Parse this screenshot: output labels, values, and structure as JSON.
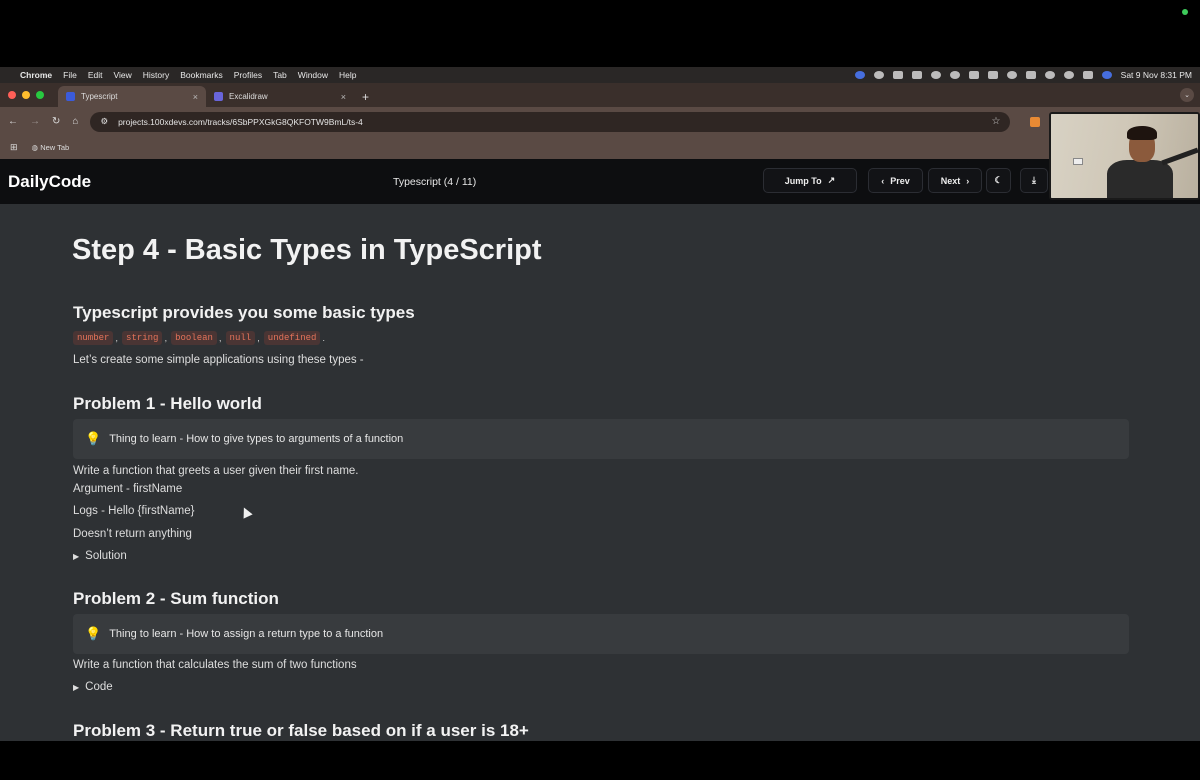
{
  "menubar": {
    "items": [
      "Chrome",
      "File",
      "Edit",
      "View",
      "History",
      "Bookmarks",
      "Profiles",
      "Tab",
      "Window",
      "Help"
    ],
    "datetime": "Sat 9 Nov  8:31 PM"
  },
  "browser": {
    "tabs": [
      {
        "label": "Typescript",
        "close": "×"
      },
      {
        "label": "Excalidraw",
        "close": "×"
      }
    ],
    "new_tab": "+",
    "url": "projects.100xdevs.com/tracks/6SbPPXGkG8QKFOTW9BmL/ts-4",
    "bookmark": "New Tab"
  },
  "site": {
    "logo": "DailyCode",
    "breadcrumb": "Typescript (4 / 11)",
    "jump_to": "Jump To",
    "prev": "Prev",
    "next": "Next"
  },
  "content": {
    "title": "Step 4 - Basic Types in TypeScript",
    "section_heading": "Typescript provides you some basic types",
    "types": [
      "number",
      "string",
      "boolean",
      "null",
      "undefined"
    ],
    "intro": "Let’s create some simple applications using these types -",
    "problem1": {
      "heading": "Problem 1 - Hello world",
      "callout": "Thing to learn - How to give types to arguments of a function",
      "line1": "Write a function that greets a user given their first name.",
      "line2": "Argument - firstName",
      "line3": "Logs - Hello {firstName}",
      "line4": "Doesn’t return anything",
      "toggle": "Solution"
    },
    "problem2": {
      "heading": "Problem 2 - Sum function",
      "callout": "Thing to learn - How to assign a return type to a function",
      "line1": "Write a function that calculates the sum of two functions",
      "toggle": "Code"
    },
    "problem3": {
      "heading": "Problem 3 - Return true or false based on if a user is 18+"
    }
  }
}
